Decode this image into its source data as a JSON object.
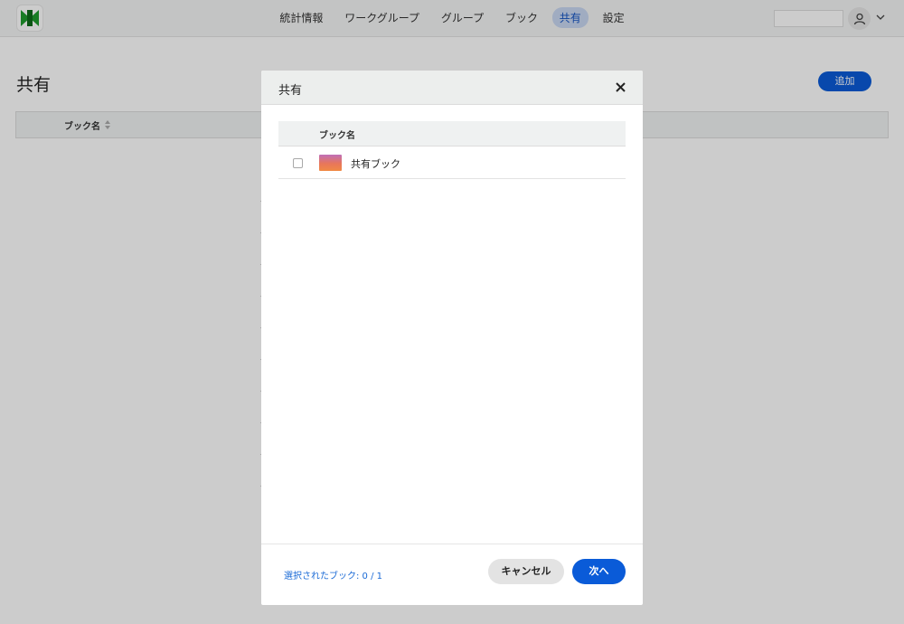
{
  "nav": {
    "items": [
      {
        "label": "統計情報",
        "active": false
      },
      {
        "label": "ワークグループ",
        "active": false
      },
      {
        "label": "グループ",
        "active": false
      },
      {
        "label": "ブック",
        "active": false
      },
      {
        "label": "共有",
        "active": true
      },
      {
        "label": "設定",
        "active": false
      }
    ]
  },
  "page": {
    "title": "共有",
    "add_label": "追加",
    "table": {
      "column_name": "ブック名"
    }
  },
  "modal": {
    "title": "共有",
    "list_header": "ブック名",
    "rows": [
      {
        "label": "共有ブック",
        "checked": false
      }
    ],
    "selected_text": "選択されたブック: 0 / 1",
    "cancel_label": "キャンセル",
    "next_label": "次へ"
  },
  "colors": {
    "accent": "#0a5bd8",
    "nav_active_bg": "#c8d7f2",
    "logo_green": "#1e9c2e"
  },
  "icons": {
    "logo": "bowtie-logo-icon",
    "avatar": "user-icon",
    "dropdown": "chevron-down-icon",
    "sort": "sort-icon",
    "close": "close-icon"
  }
}
